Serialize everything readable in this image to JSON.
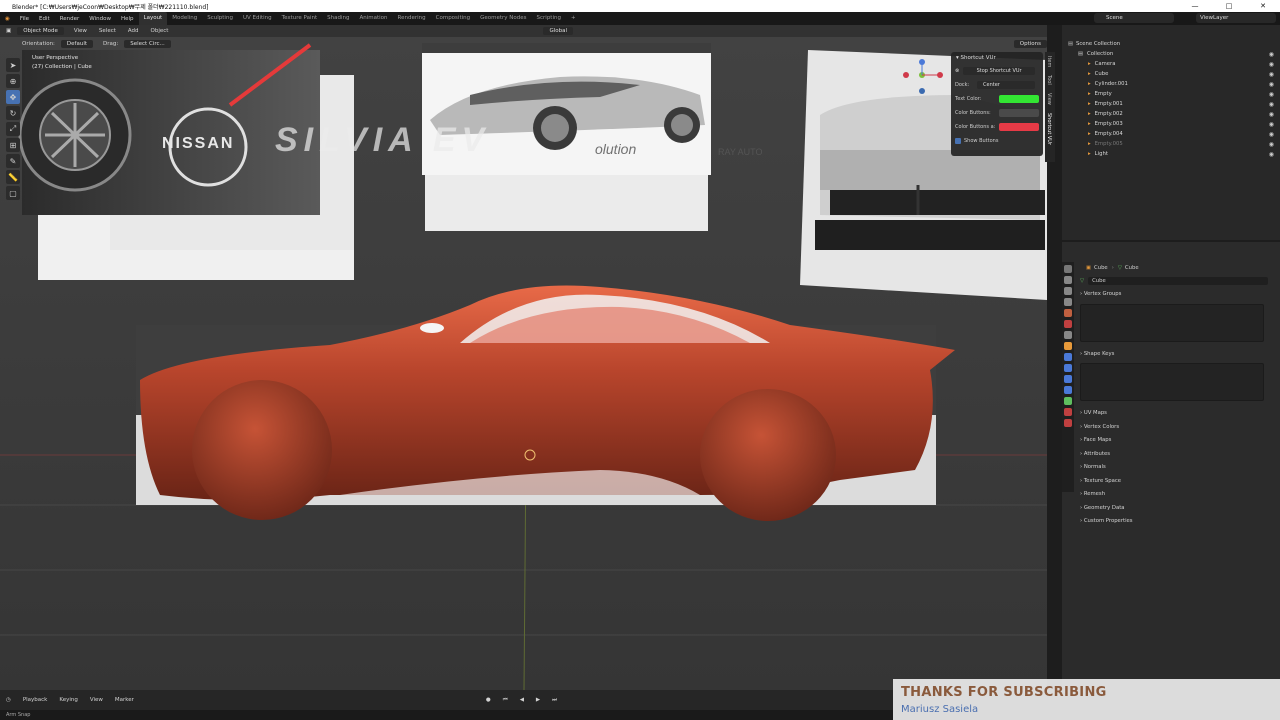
{
  "window": {
    "title": "Blender* [C:₩Users₩jeCoon₩Desktop₩무제 폴더₩221110.blend]",
    "controls": [
      "—",
      "□",
      "✕"
    ]
  },
  "menu": [
    "File",
    "Edit",
    "Render",
    "Window",
    "Help"
  ],
  "workspaces": [
    "Layout",
    "Modeling",
    "Sculpting",
    "UV Editing",
    "Texture Paint",
    "Shading",
    "Animation",
    "Rendering",
    "Compositing",
    "Geometry Nodes",
    "Scripting",
    "+"
  ],
  "scene": "Scene",
  "view_layer": "ViewLayer",
  "viewport_header": {
    "mode": "Object Mode",
    "menus": [
      "View",
      "Select",
      "Add",
      "Object"
    ],
    "transform": "Global",
    "options": "Options"
  },
  "viewport_header2": {
    "orientation_label": "Orientation:",
    "orientation_value": "Default",
    "drag_label": "Drag:",
    "drag_value": "Select Circ..."
  },
  "viewport_info": {
    "line1": "User Perspective",
    "line2": "(27) Collection | Cube"
  },
  "overlay_text": {
    "brand": "NISSAN",
    "model": "SILVIA EV",
    "tagline": "olution",
    "credit": "RAY AUTO"
  },
  "npanel": {
    "header": "Shortcut VUr",
    "stop_button": "Stop Shortcut VUr",
    "dock_label": "Dock:",
    "dock_value": "Center",
    "text_color_label": "Text Color:",
    "color_buttons_label": "Color Buttons:",
    "color_buttons_a_label": "Color Buttons a:",
    "show_buttons_label": "Show Buttons",
    "text_color": "#33e633",
    "color_buttons": "#4a4a4a",
    "color_buttons_a": "#e63a46",
    "tabs": [
      "Item",
      "Tool",
      "View",
      "Shortcut VUr"
    ]
  },
  "outliner": {
    "title": "Scene Collection",
    "items": [
      {
        "label": "Collection",
        "level": 1
      },
      {
        "label": "Camera",
        "level": 2
      },
      {
        "label": "Cube",
        "level": 2
      },
      {
        "label": "Cylinder.001",
        "level": 2
      },
      {
        "label": "Empty",
        "level": 2
      },
      {
        "label": "Empty.001",
        "level": 2
      },
      {
        "label": "Empty.002",
        "level": 2
      },
      {
        "label": "Empty.003",
        "level": 2
      },
      {
        "label": "Empty.004",
        "level": 2
      },
      {
        "label": "Empty.005",
        "level": 2
      },
      {
        "label": "Light",
        "level": 2
      }
    ]
  },
  "properties": {
    "breadcrumb_obj": "Cube",
    "breadcrumb_data": "Cube",
    "data_name": "Cube",
    "sections": [
      "Vertex Groups",
      "Shape Keys",
      "UV Maps",
      "Vertex Colors",
      "Face Maps",
      "Attributes",
      "Normals",
      "Texture Space",
      "Remesh",
      "Geometry Data",
      "Custom Properties"
    ]
  },
  "timeline": {
    "items": [
      "Playback",
      "Keying",
      "View",
      "Marker"
    ]
  },
  "status": "Arm Snap",
  "banner": {
    "title": "THANKS FOR SUBSCRIBING",
    "name": "Mariusz Sasiela"
  }
}
